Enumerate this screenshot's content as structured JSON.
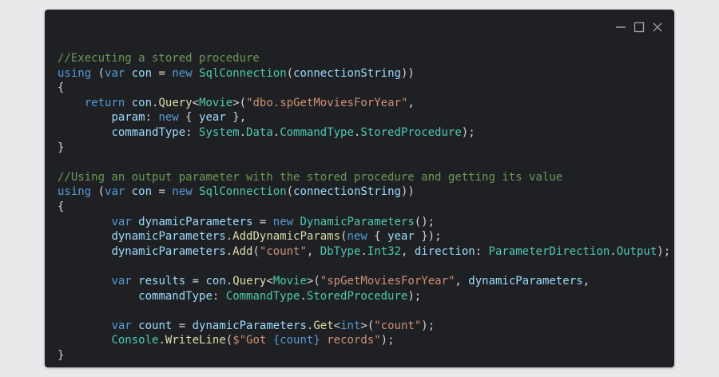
{
  "window": {
    "controls": [
      "minimize",
      "maximize",
      "close"
    ]
  },
  "colors": {
    "background": "#1f2023",
    "comment": "#6a9955",
    "keyword": "#569cd6",
    "variable": "#9cdcfe",
    "function": "#dcdcaa",
    "type": "#4ec9b0",
    "string": "#ce9178",
    "plain": "#d4d4d4"
  },
  "code_lines": [
    [
      {
        "t": "//Executing a stored procedure",
        "c": "comment"
      }
    ],
    [
      {
        "t": "using",
        "c": "kw"
      },
      {
        "t": " (",
        "c": "punc"
      },
      {
        "t": "var",
        "c": "kw"
      },
      {
        "t": " ",
        "c": "punc"
      },
      {
        "t": "con",
        "c": "var"
      },
      {
        "t": " = ",
        "c": "punc"
      },
      {
        "t": "new",
        "c": "kw"
      },
      {
        "t": " ",
        "c": "punc"
      },
      {
        "t": "SqlConnection",
        "c": "type"
      },
      {
        "t": "(",
        "c": "punc"
      },
      {
        "t": "connectionString",
        "c": "var"
      },
      {
        "t": "))",
        "c": "punc"
      }
    ],
    [
      {
        "t": "{",
        "c": "punc"
      }
    ],
    [
      {
        "t": "    ",
        "c": "punc"
      },
      {
        "t": "return",
        "c": "kw"
      },
      {
        "t": " ",
        "c": "punc"
      },
      {
        "t": "con",
        "c": "var"
      },
      {
        "t": ".",
        "c": "punc"
      },
      {
        "t": "Query",
        "c": "fn"
      },
      {
        "t": "<",
        "c": "punc"
      },
      {
        "t": "Movie",
        "c": "type"
      },
      {
        "t": ">(",
        "c": "punc"
      },
      {
        "t": "\"dbo.spGetMoviesForYear\"",
        "c": "str"
      },
      {
        "t": ",",
        "c": "punc"
      }
    ],
    [
      {
        "t": "        ",
        "c": "punc"
      },
      {
        "t": "param",
        "c": "var"
      },
      {
        "t": ": ",
        "c": "punc"
      },
      {
        "t": "new",
        "c": "kw"
      },
      {
        "t": " { ",
        "c": "punc"
      },
      {
        "t": "year",
        "c": "var"
      },
      {
        "t": " },",
        "c": "punc"
      }
    ],
    [
      {
        "t": "        ",
        "c": "punc"
      },
      {
        "t": "commandType",
        "c": "var"
      },
      {
        "t": ": ",
        "c": "punc"
      },
      {
        "t": "System",
        "c": "type"
      },
      {
        "t": ".",
        "c": "punc"
      },
      {
        "t": "Data",
        "c": "type"
      },
      {
        "t": ".",
        "c": "punc"
      },
      {
        "t": "CommandType",
        "c": "type"
      },
      {
        "t": ".",
        "c": "punc"
      },
      {
        "t": "StoredProcedure",
        "c": "type"
      },
      {
        "t": ");",
        "c": "punc"
      }
    ],
    [
      {
        "t": "}",
        "c": "punc"
      }
    ],
    [],
    [
      {
        "t": "//Using an output parameter with the stored procedure and getting its value",
        "c": "comment"
      }
    ],
    [
      {
        "t": "using",
        "c": "kw"
      },
      {
        "t": " (",
        "c": "punc"
      },
      {
        "t": "var",
        "c": "kw"
      },
      {
        "t": " ",
        "c": "punc"
      },
      {
        "t": "con",
        "c": "var"
      },
      {
        "t": " = ",
        "c": "punc"
      },
      {
        "t": "new",
        "c": "kw"
      },
      {
        "t": " ",
        "c": "punc"
      },
      {
        "t": "SqlConnection",
        "c": "type"
      },
      {
        "t": "(",
        "c": "punc"
      },
      {
        "t": "connectionString",
        "c": "var"
      },
      {
        "t": "))",
        "c": "punc"
      }
    ],
    [
      {
        "t": "{",
        "c": "punc"
      }
    ],
    [
      {
        "t": "        ",
        "c": "punc"
      },
      {
        "t": "var",
        "c": "kw"
      },
      {
        "t": " ",
        "c": "punc"
      },
      {
        "t": "dynamicParameters",
        "c": "var"
      },
      {
        "t": " = ",
        "c": "punc"
      },
      {
        "t": "new",
        "c": "kw"
      },
      {
        "t": " ",
        "c": "punc"
      },
      {
        "t": "DynamicParameters",
        "c": "type"
      },
      {
        "t": "();",
        "c": "punc"
      }
    ],
    [
      {
        "t": "        ",
        "c": "punc"
      },
      {
        "t": "dynamicParameters",
        "c": "var"
      },
      {
        "t": ".",
        "c": "punc"
      },
      {
        "t": "AddDynamicParams",
        "c": "fn"
      },
      {
        "t": "(",
        "c": "punc"
      },
      {
        "t": "new",
        "c": "kw"
      },
      {
        "t": " { ",
        "c": "punc"
      },
      {
        "t": "year",
        "c": "var"
      },
      {
        "t": " });",
        "c": "punc"
      }
    ],
    [
      {
        "t": "        ",
        "c": "punc"
      },
      {
        "t": "dynamicParameters",
        "c": "var"
      },
      {
        "t": ".",
        "c": "punc"
      },
      {
        "t": "Add",
        "c": "fn"
      },
      {
        "t": "(",
        "c": "punc"
      },
      {
        "t": "\"count\"",
        "c": "str"
      },
      {
        "t": ", ",
        "c": "punc"
      },
      {
        "t": "DbType",
        "c": "type"
      },
      {
        "t": ".",
        "c": "punc"
      },
      {
        "t": "Int32",
        "c": "type"
      },
      {
        "t": ", ",
        "c": "punc"
      },
      {
        "t": "direction",
        "c": "var"
      },
      {
        "t": ": ",
        "c": "punc"
      },
      {
        "t": "ParameterDirection",
        "c": "type"
      },
      {
        "t": ".",
        "c": "punc"
      },
      {
        "t": "Output",
        "c": "type"
      },
      {
        "t": ");",
        "c": "punc"
      }
    ],
    [],
    [
      {
        "t": "        ",
        "c": "punc"
      },
      {
        "t": "var",
        "c": "kw"
      },
      {
        "t": " ",
        "c": "punc"
      },
      {
        "t": "results",
        "c": "var"
      },
      {
        "t": " = ",
        "c": "punc"
      },
      {
        "t": "con",
        "c": "var"
      },
      {
        "t": ".",
        "c": "punc"
      },
      {
        "t": "Query",
        "c": "fn"
      },
      {
        "t": "<",
        "c": "punc"
      },
      {
        "t": "Movie",
        "c": "type"
      },
      {
        "t": ">(",
        "c": "punc"
      },
      {
        "t": "\"spGetMoviesForYear\"",
        "c": "str"
      },
      {
        "t": ", ",
        "c": "punc"
      },
      {
        "t": "dynamicParameters",
        "c": "var"
      },
      {
        "t": ",",
        "c": "punc"
      }
    ],
    [
      {
        "t": "            ",
        "c": "punc"
      },
      {
        "t": "commandType",
        "c": "var"
      },
      {
        "t": ": ",
        "c": "punc"
      },
      {
        "t": "CommandType",
        "c": "type"
      },
      {
        "t": ".",
        "c": "punc"
      },
      {
        "t": "StoredProcedure",
        "c": "type"
      },
      {
        "t": ");",
        "c": "punc"
      }
    ],
    [],
    [
      {
        "t": "        ",
        "c": "punc"
      },
      {
        "t": "var",
        "c": "kw"
      },
      {
        "t": " ",
        "c": "punc"
      },
      {
        "t": "count",
        "c": "var"
      },
      {
        "t": " = ",
        "c": "punc"
      },
      {
        "t": "dynamicParameters",
        "c": "var"
      },
      {
        "t": ".",
        "c": "punc"
      },
      {
        "t": "Get",
        "c": "fn"
      },
      {
        "t": "<",
        "c": "punc"
      },
      {
        "t": "int",
        "c": "kw"
      },
      {
        "t": ">(",
        "c": "punc"
      },
      {
        "t": "\"count\"",
        "c": "str"
      },
      {
        "t": ");",
        "c": "punc"
      }
    ],
    [
      {
        "t": "        ",
        "c": "punc"
      },
      {
        "t": "Console",
        "c": "type"
      },
      {
        "t": ".",
        "c": "punc"
      },
      {
        "t": "WriteLine",
        "c": "fn"
      },
      {
        "t": "(",
        "c": "punc"
      },
      {
        "t": "$\"Got ",
        "c": "str"
      },
      {
        "t": "{count}",
        "c": "kw"
      },
      {
        "t": " records\"",
        "c": "str"
      },
      {
        "t": ");",
        "c": "punc"
      }
    ],
    [
      {
        "t": "}",
        "c": "punc"
      }
    ]
  ]
}
